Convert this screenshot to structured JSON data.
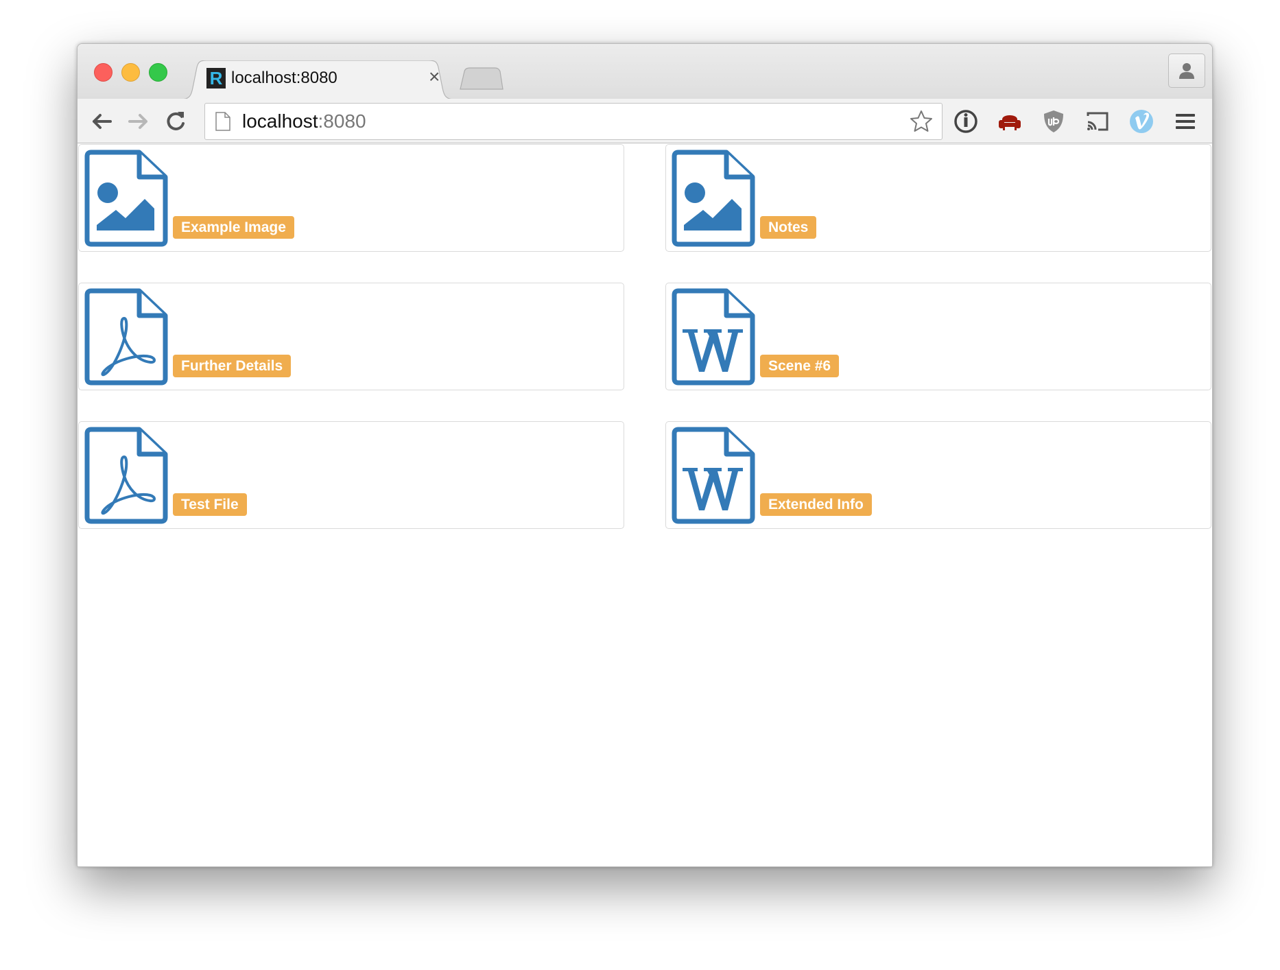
{
  "browser": {
    "tab": {
      "title": "localhost:8080",
      "favicon_letter": "R",
      "close_glyph": "×"
    },
    "omnibox": {
      "host": "localhost",
      "port": ":8080"
    },
    "toolbar_icons": [
      "back-arrow-icon",
      "forward-arrow-icon",
      "reload-icon",
      "info-icon",
      "armchair-icon",
      "ublock-shield-icon",
      "cast-icon",
      "vimeo-icon",
      "menu-icon"
    ]
  },
  "colors": {
    "accent": "#337ab7",
    "badge": "#f0ad4e",
    "badge_text": "#ffffff"
  },
  "files": [
    {
      "label": "Example Image",
      "icon": "image-file-icon"
    },
    {
      "label": "Notes",
      "icon": "image-file-icon"
    },
    {
      "label": "Further Details",
      "icon": "pdf-file-icon"
    },
    {
      "label": "Scene #6",
      "icon": "word-file-icon"
    },
    {
      "label": "Test File",
      "icon": "pdf-file-icon"
    },
    {
      "label": "Extended Info",
      "icon": "word-file-icon"
    }
  ]
}
